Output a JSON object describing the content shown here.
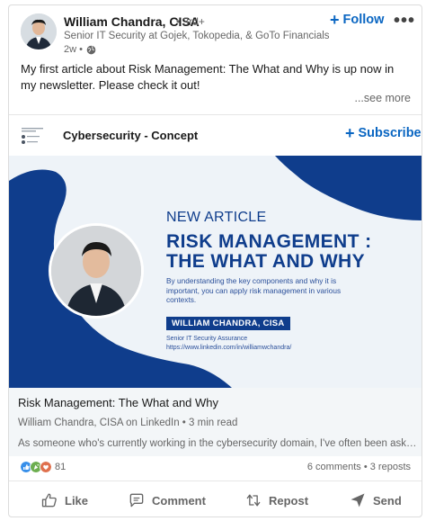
{
  "post": {
    "author": {
      "name": "William Chandra, CISA",
      "degree": "• 3rd+",
      "headline": "Senior IT Security at Gojek, Tokopedia, & GoTo Financials",
      "time": "2w •",
      "follow_label": "Follow"
    },
    "more_menu": "•••",
    "text": "My first article about Risk Management: The What and Why is up now in my newsletter. Please check it out!",
    "see_more": "...see more"
  },
  "newsletter": {
    "title": "Cybersecurity - Concept",
    "subscribe_label": "Subscribe"
  },
  "banner": {
    "label": "NEW ARTICLE",
    "title_line1": "RISK MANAGEMENT :",
    "title_line2": "THE WHAT AND WHY",
    "description": "By understanding the key components and why it is important, you can apply risk management in various contexts.",
    "name_tag": "WILLIAM CHANDRA, CISA",
    "role": "Senior IT Security Assurance",
    "url": "https://www.linkedin.com/in/williamwchandra/",
    "colors": {
      "navy": "#0f3d8c",
      "background": "#eef3f8"
    }
  },
  "article": {
    "title": "Risk Management: The What and Why",
    "meta": "William Chandra, CISA on LinkedIn • 3 min read",
    "excerpt": "As someone who's currently working in the cybersecurity domain, I've often been asked about h..."
  },
  "social": {
    "reaction_count": "81",
    "stats": "6 comments • 3 reposts",
    "reaction_icons": [
      "like-icon",
      "celebrate-icon",
      "love-icon"
    ]
  },
  "actions": {
    "like": "Like",
    "comment": "Comment",
    "repost": "Repost",
    "send": "Send"
  },
  "colors": {
    "accent": "#0a66c2",
    "muted_text": "#666666"
  }
}
